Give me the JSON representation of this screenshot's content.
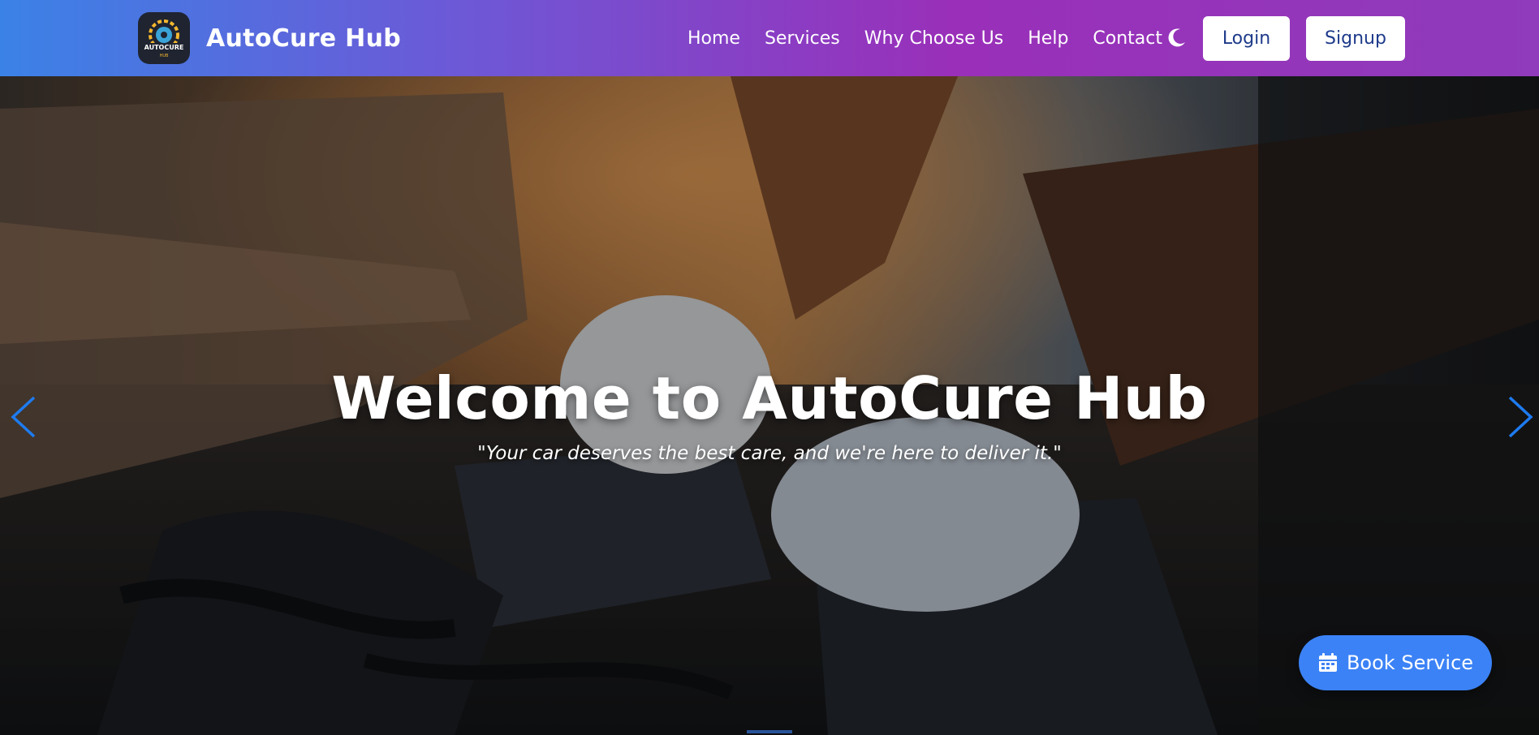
{
  "brand": {
    "logo_text": "AUTOCURE",
    "logo_subtext": "HUB",
    "title": "AutoCure Hub"
  },
  "nav": {
    "links": [
      "Home",
      "Services",
      "Why Choose Us",
      "Help",
      "Contact"
    ],
    "theme_icon": "moon-icon",
    "login_label": "Login",
    "signup_label": "Signup"
  },
  "hero": {
    "title": "Welcome to AutoCure Hub",
    "tagline": "\"Your car deserves the best care, and we're here to deliver it.\"",
    "prev_icon": "chevron-left-icon",
    "next_icon": "chevron-right-icon"
  },
  "book_service": {
    "label": "Book Service",
    "icon": "calendar-icon"
  },
  "colors": {
    "nav_gradient_start": "#3b82e6",
    "nav_gradient_mid": "#9a2fb9",
    "accent_blue": "#3b82f6",
    "button_text": "#1e3a8a"
  }
}
